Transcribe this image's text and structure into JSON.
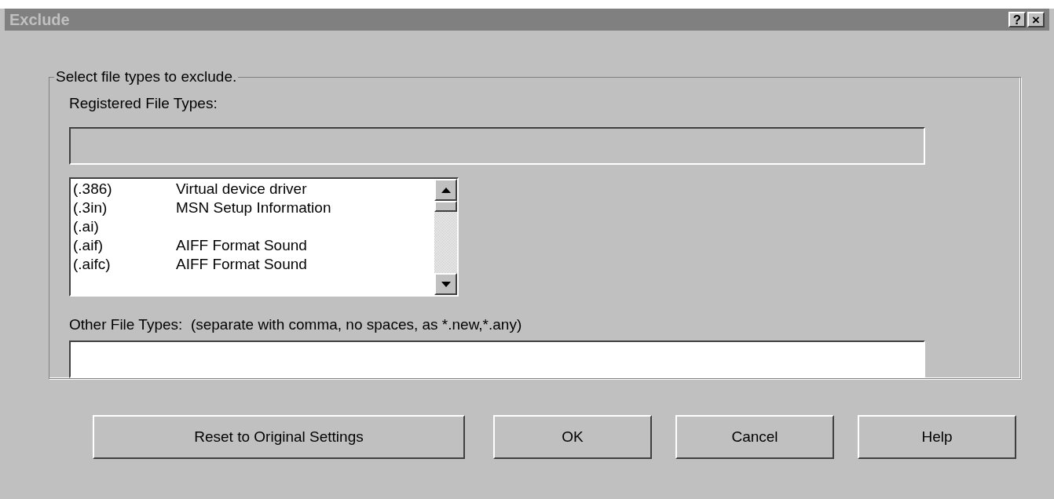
{
  "window": {
    "title": "Exclude",
    "title_buttons": [
      "?",
      "×"
    ]
  },
  "group": {
    "legend": "Select file types to exclude.",
    "registered_label": "Registered File Types:",
    "registered_field": {
      "disabled": true
    },
    "file_types": [
      {
        "extension": "(.386)",
        "description": "Virtual device driver"
      },
      {
        "extension": "(.3in)",
        "description": "MSN Setup Information"
      },
      {
        "extension": "(.ai)"
      },
      {
        "extension": "(.aif)",
        "description": "AIFF Format Sound"
      },
      {
        "extension": "(.aifc)",
        "description": "AIFF Format Sound"
      }
    ],
    "other_label": "Other File Types:  (separate with comma, no spaces, as *.new,*.any)",
    "other_field": {
      "disabled": false
    }
  },
  "buttons": [
    "Reset to Original Settings",
    "OK",
    "Cancel",
    "Help"
  ]
}
